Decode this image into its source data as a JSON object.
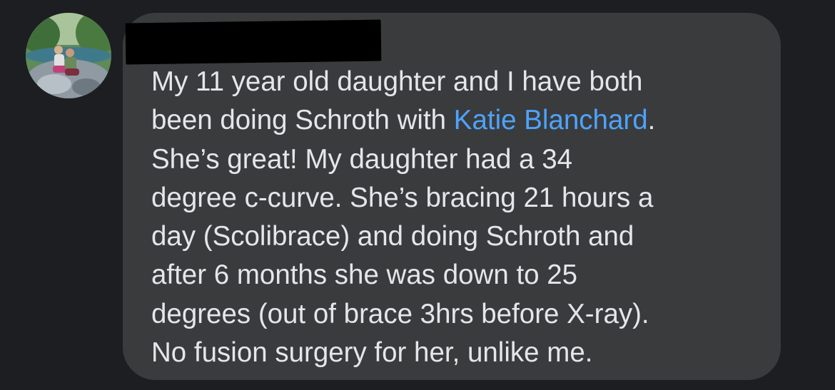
{
  "comment": {
    "author_avatar_icon": "profile-photo",
    "author_name_redacted": true,
    "text_part1": "My 11 year old daughter and I have both\nbeen doing Schroth with ",
    "mention": "Katie Blanchard",
    "text_part2": ".\nShe’s great! My daughter had a 34\ndegree c-curve. She’s bracing 21 hours a\nday (Scolibrace) and doing Schroth and\nafter 6 months she was down to 25\ndegrees (out of brace 3hrs before X-ray).\nNo fusion surgery for her, unlike me.",
    "colors": {
      "background": "#1c1e21",
      "bubble": "#3a3b3c",
      "text": "#e4e6eb",
      "mention": "#4ea3ff"
    }
  }
}
